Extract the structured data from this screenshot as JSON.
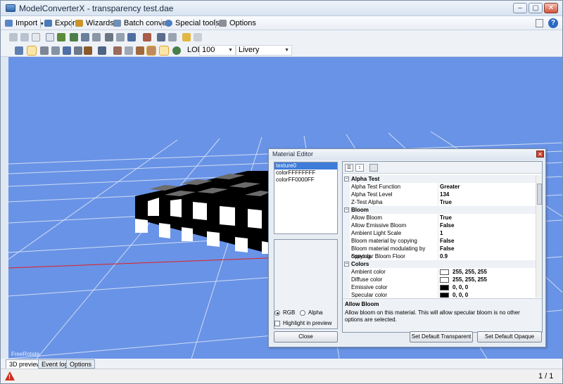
{
  "window": {
    "title": "ModelConverterX - transparency test.dae"
  },
  "menubar": {
    "items": [
      {
        "label": "Import",
        "icon": "import-icon",
        "dropdown": true
      },
      {
        "label": "Export",
        "icon": "export-icon",
        "dropdown": false
      },
      {
        "label": "Wizards",
        "icon": "wizard-wand-icon",
        "dropdown": true
      },
      {
        "label": "Batch convert",
        "icon": "batch-convert-icon",
        "dropdown": false
      },
      {
        "label": "Special tools",
        "icon": "special-tools-icon",
        "dropdown": true
      },
      {
        "label": "Options",
        "icon": "options-wrench-icon",
        "dropdown": false
      }
    ]
  },
  "toolbar": {
    "lod_label": "LOD",
    "lod_value": "100",
    "livery_value": "Livery"
  },
  "viewport": {
    "mode_label": "FreeRotate",
    "background_color": "#6993e6"
  },
  "tabs": [
    {
      "label": "3D preview",
      "active": true
    },
    {
      "label": "Event log",
      "active": false
    },
    {
      "label": "Options",
      "active": false
    }
  ],
  "status": {
    "pager": "1 / 1"
  },
  "material_editor": {
    "title": "Material Editor",
    "textures": [
      "texture0",
      "colorFFFFFFFF",
      "colorFF0000FF"
    ],
    "selected_texture": "texture0",
    "rgb_label": "RGB",
    "alpha_label": "Alpha",
    "highlight_label": "Highlight in preview",
    "close_label": "Close",
    "set_transparent_label": "Set Default Transparent",
    "set_opaque_label": "Set Default Opaque",
    "categories": [
      {
        "name": "Alpha Test",
        "props": [
          {
            "name": "Alpha Test Function",
            "value": "Greater"
          },
          {
            "name": "Alpha Test Level",
            "value": "134"
          },
          {
            "name": "Z-Test Alpha",
            "value": "True"
          }
        ]
      },
      {
        "name": "Bloom",
        "props": [
          {
            "name": "Allow Bloom",
            "value": "True"
          },
          {
            "name": "Allow Emissive Bloom",
            "value": "False"
          },
          {
            "name": "Ambient Light Scale",
            "value": "1"
          },
          {
            "name": "Bloom material by copying",
            "value": "False"
          },
          {
            "name": "Bloom material modulating by copying",
            "value": "False"
          },
          {
            "name": "Specular Bloom Floor",
            "value": "0.9"
          }
        ]
      },
      {
        "name": "Colors",
        "props": [
          {
            "name": "Ambient color",
            "value": "255, 255, 255",
            "swatch": "#ffffff"
          },
          {
            "name": "Diffuse color",
            "value": "255, 255, 255",
            "swatch": "#ffffff"
          },
          {
            "name": "Emissive color",
            "value": "0, 0, 0",
            "swatch": "#000000"
          },
          {
            "name": "Specular color",
            "value": "0, 0, 0",
            "swatch": "#000000"
          }
        ]
      }
    ],
    "description": {
      "title": "Allow Bloom",
      "text": "Allow bloom on this material. This will allow specular bloom is no other options are selected."
    }
  }
}
